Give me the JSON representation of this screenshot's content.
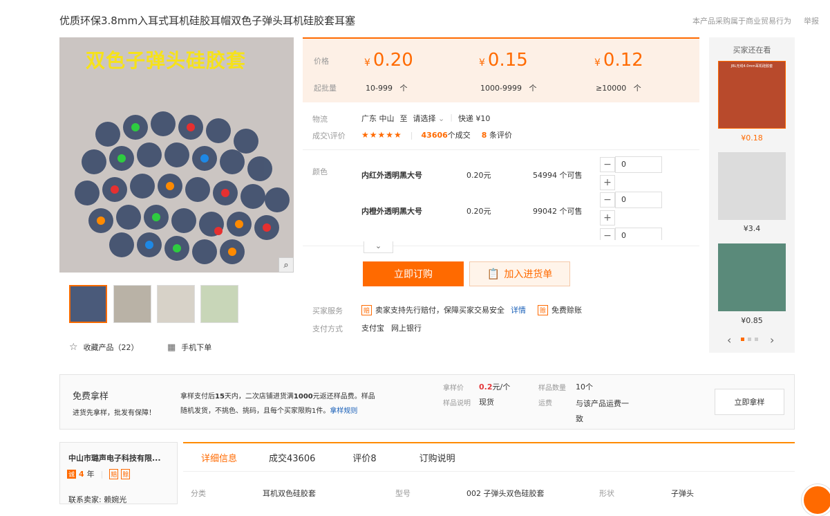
{
  "product": {
    "title": "优质环保3.8mm入耳式耳机硅胶耳帽双色子弹头耳机硅胶套耳塞",
    "notice": "本产品采购属于商业贸易行为",
    "report": "举报",
    "main_image_text": "双色子弹头硅胶套",
    "favorite": "收藏产品（22）",
    "mobile_order": "手机下单"
  },
  "pricing": {
    "price_label": "价格",
    "moq_label": "起批量",
    "currency": "¥",
    "tiers": [
      {
        "price": "0.20",
        "range": "10-999",
        "unit": "个"
      },
      {
        "price": "0.15",
        "range": "1000-9999",
        "unit": "个"
      },
      {
        "price": "0.12",
        "range": "≥10000",
        "unit": "个"
      }
    ]
  },
  "logistics": {
    "label": "物流",
    "from": "广东 中山",
    "to": "至",
    "select": "请选择",
    "shipping": "快递 ¥10"
  },
  "deals": {
    "label": "成交\\评价",
    "rating": 5,
    "deal_count": "43606",
    "deal_suffix": "个成交",
    "review_count": "8",
    "review_suffix": "条评价"
  },
  "variants": {
    "label": "颜色",
    "items": [
      {
        "name": "内红外透明黑大号",
        "price": "0.20元",
        "stock": "54994 个可售",
        "qty": "0"
      },
      {
        "name": "内橙外透明黑大号",
        "price": "0.20元",
        "stock": "99042 个可售",
        "qty": "0"
      },
      {
        "name": "",
        "price": "",
        "stock": "",
        "qty": "0"
      }
    ],
    "minus": "−",
    "plus": "+"
  },
  "actions": {
    "buy_now": "立即订购",
    "add_to_cart": "加入进货单"
  },
  "services": {
    "label": "买家服务",
    "guarantee": "卖家支持先行赔付，保障买家交易安全",
    "details_link": "详情",
    "free_credit": "免费赊账",
    "payment_label": "支付方式",
    "methods": [
      "支付宝",
      "网上银行"
    ]
  },
  "sidebar": {
    "title": "买家还在看",
    "items": [
      {
        "price": "¥0.18",
        "img_text": "JBL无线4.0mm耳机硅胶套"
      },
      {
        "price": "¥3.4"
      },
      {
        "price": "¥0.85"
      }
    ]
  },
  "sample": {
    "title": "免费拿样",
    "subtitle": "进货先拿样，批发有保障！",
    "desc_1_pre": "拿样支付后",
    "desc_1_days": "15",
    "desc_1_mid": "天内，二次店铺进货满",
    "desc_1_amount": "1000",
    "desc_1_post": "元返还样品费。样品",
    "desc_2": "随机发货，不挑色、挑码，且每个买家限购1件。",
    "rules_link": "拿样规则",
    "price_label": "拿样价",
    "price_value": "0.2",
    "price_unit": "元/个",
    "qty_label": "样品数量",
    "qty_value": "10个",
    "note_label": "样品说明",
    "note_value": "现货",
    "freight_label": "运费",
    "freight_value_1": "与该产品运费一",
    "freight_value_2": "致",
    "button": "立即拿样"
  },
  "company": {
    "name": "中山市璐声电子科技有限...",
    "years": "4",
    "years_unit": "年",
    "contact": "联系卖家: 赖婉光"
  },
  "tabs": [
    "详细信息",
    "成交43606",
    "评价8",
    "订购说明"
  ],
  "attributes": [
    {
      "key": "分类",
      "value": "耳机双色硅胶套"
    },
    {
      "key": "型号",
      "value": "002 子弹头双色硅胶套"
    },
    {
      "key": "形状",
      "value": "子弹头"
    }
  ],
  "colors": {
    "accent": "#ff6a00",
    "price_bg": "#fdf0e6"
  }
}
